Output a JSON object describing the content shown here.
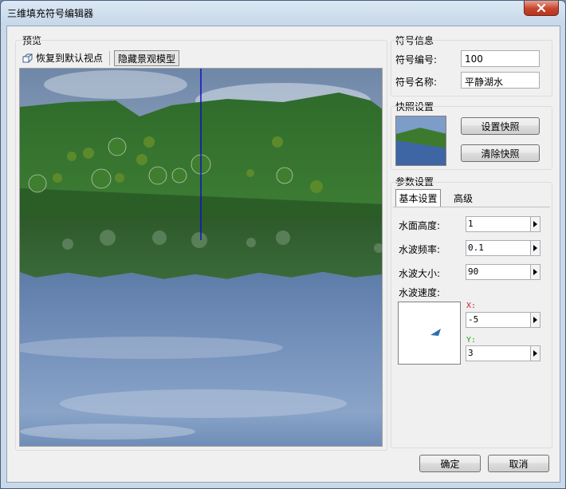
{
  "window": {
    "title": "三维填充符号编辑器"
  },
  "preview": {
    "section_title": "预览",
    "restore_view_label": "恢复到默认视点",
    "hide_model_label": "隐藏景观模型"
  },
  "symbol_info": {
    "section_title": "符号信息",
    "id_label": "符号编号:",
    "id_value": "100",
    "name_label": "符号名称:",
    "name_value": "平静湖水"
  },
  "snapshot": {
    "section_title": "快照设置",
    "set_label": "设置快照",
    "clear_label": "清除快照"
  },
  "params": {
    "section_title": "参数设置",
    "tabs": [
      {
        "label": "基本设置",
        "active": true
      },
      {
        "label": "高级",
        "active": false
      }
    ],
    "water_height_label": "水面高度:",
    "water_height_value": "1",
    "wave_freq_label": "水波频率:",
    "wave_freq_value": "0.1",
    "wave_size_label": "水波大小:",
    "wave_size_value": "90",
    "wave_speed_label": "水波速度:",
    "x_label": "X:",
    "x_value": "-5",
    "y_label": "Y:",
    "y_value": "3"
  },
  "footer": {
    "ok_label": "确定",
    "cancel_label": "取消"
  },
  "colors": {
    "close_red": "#c8442c",
    "axis_x": "#d02020",
    "axis_y": "#20a020",
    "direction_arrow": "#2a6db3"
  },
  "icons": [
    "close-icon",
    "restore-view-icon",
    "spin-right-icon",
    "direction-arrow-icon"
  ]
}
